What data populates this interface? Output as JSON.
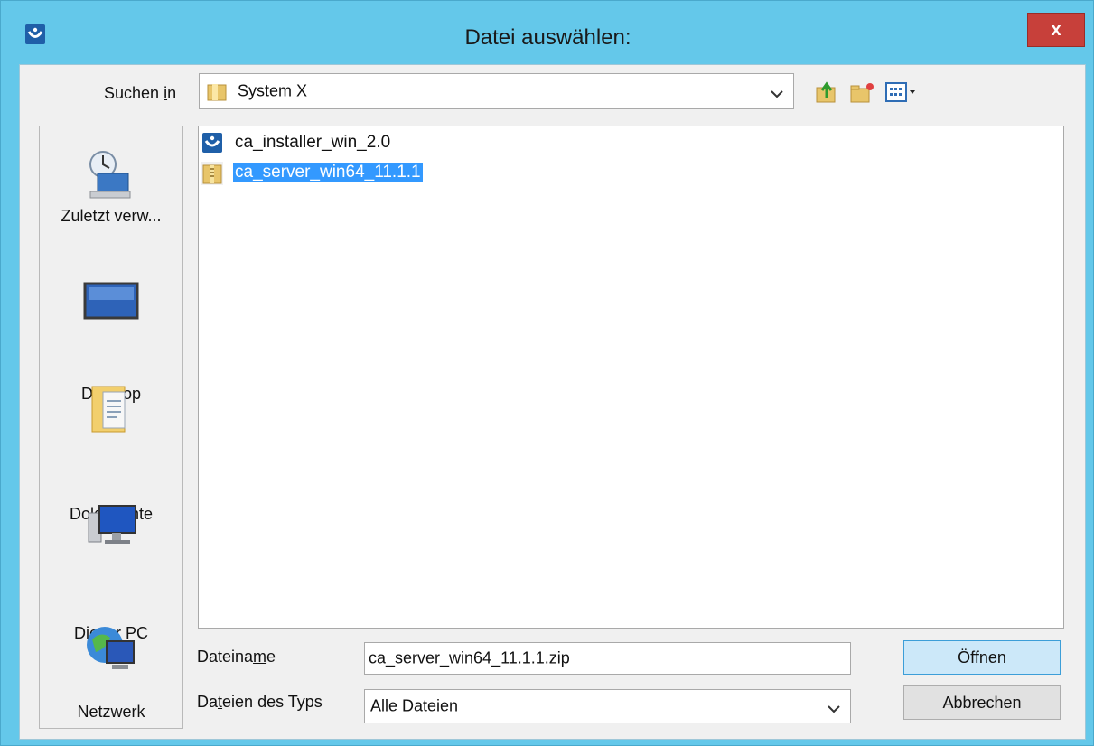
{
  "window": {
    "title": "Datei auswählen:",
    "close_label": "x"
  },
  "lookin": {
    "label_prefix": "Suchen ",
    "label_mnemonic": "i",
    "label_suffix": "n",
    "value": "System X"
  },
  "toolbar": {
    "icons": [
      "up-one-level-icon",
      "new-folder-icon",
      "view-menu-icon"
    ]
  },
  "places": [
    {
      "label": "Zuletzt verw...",
      "icon": "recent-items-icon"
    },
    {
      "label": "Desktop",
      "icon": "desktop-icon"
    },
    {
      "label": "Dokumente",
      "icon": "documents-icon"
    },
    {
      "label": "Dieser PC",
      "icon": "this-pc-icon"
    },
    {
      "label": "Netzwerk",
      "icon": "network-icon"
    }
  ],
  "files": [
    {
      "name": "ca_installer_win_2.0",
      "icon": "installer-icon",
      "selected": false
    },
    {
      "name": "ca_server_win64_11.1.1",
      "icon": "zip-folder-icon",
      "selected": true
    }
  ],
  "filename": {
    "label_prefix": "Dateina",
    "label_mnemonic": "m",
    "label_suffix": "e",
    "value": "ca_server_win64_11.1.1.zip"
  },
  "filetype": {
    "label_prefix": "Da",
    "label_mnemonic": "t",
    "label_suffix": "eien des Typs",
    "value": "Alle Dateien"
  },
  "buttons": {
    "open": "Öffnen",
    "cancel": "Abbrechen"
  },
  "colors": {
    "titlebar": "#64c8ea",
    "close": "#c7403a",
    "selection": "#3399ff",
    "primary_button": "#cce8f9"
  }
}
